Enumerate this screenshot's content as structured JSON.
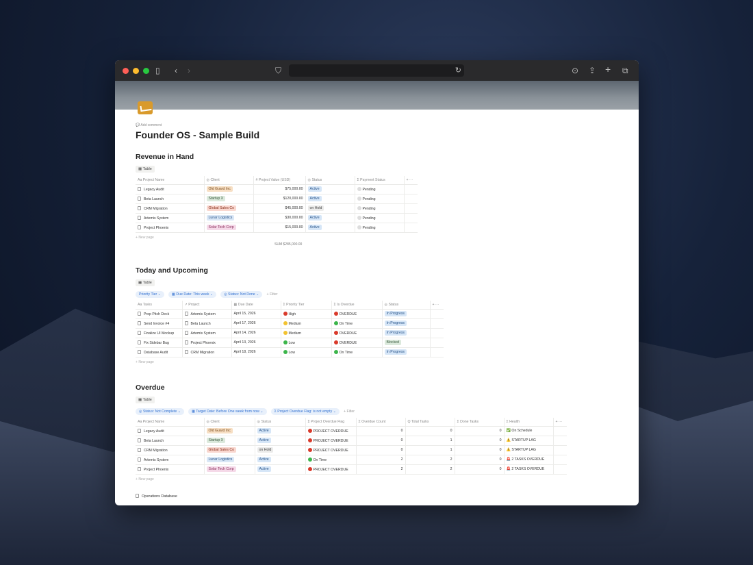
{
  "page": {
    "title": "Founder OS - Sample Build",
    "add_comment": "Add comment"
  },
  "colors": {
    "accent": "#2f6fd0",
    "status_blue": "#d9e7f6"
  },
  "revenue": {
    "title": "Revenue in Hand",
    "view": "Table",
    "columns": [
      "Aa  Project Name",
      "◎  Client",
      "#  Project Value (USD)",
      "◎  Status",
      "Σ  Payment Status",
      "+  ···"
    ],
    "rows": [
      {
        "name": "Legacy Audit",
        "client": "Old Guard Inc",
        "client_color": "orange",
        "value": "$75,000.00",
        "status": "Active",
        "payment": "Pending"
      },
      {
        "name": "Beta Launch",
        "client": "Startup X",
        "client_color": "green",
        "value": "$120,000.00",
        "status": "Active",
        "payment": "Pending"
      },
      {
        "name": "CRM Migration",
        "client": "Global Sales Co",
        "client_color": "red",
        "value": "$45,000.00",
        "status": "on Hold",
        "payment": "Pending"
      },
      {
        "name": "Artemis System",
        "client": "Lunar Logistics",
        "client_color": "blue",
        "value": "$30,000.00",
        "status": "Active",
        "payment": "Pending"
      },
      {
        "name": "Project Phoenix",
        "client": "Solar Tech Corp",
        "client_color": "pink",
        "value": "$15,000.00",
        "status": "Active",
        "payment": "Pending"
      }
    ],
    "new_page": "New page",
    "sum_label": "SUM",
    "sum_value": "$285,000.00"
  },
  "upcoming": {
    "title": "Today and Upcoming",
    "view": "Table",
    "filters": [
      "Priority Tier ⌄",
      "▦ Due Date: This week ⌄",
      "◎ Status: Not Done ⌄"
    ],
    "filter_add": "+ Filter",
    "columns": [
      "Aa  Tasks",
      "↗  Project",
      "▦  Due Date",
      "Σ  Priority Tier",
      "Σ  Is Overdue",
      "◎  Status",
      "+  ···"
    ],
    "rows": [
      {
        "task": "Prep Pitch Deck",
        "project": "Artemis System",
        "due": "April 15, 2026",
        "priority": "High",
        "prio_color": "#d93a2b",
        "overdue": "OVERDUE",
        "od_color": "#d93a2b",
        "status": "In Progress"
      },
      {
        "task": "Send Invoice #4",
        "project": "Beta Launch",
        "due": "April 17, 2026",
        "priority": "Medium",
        "prio_color": "#f2c230",
        "overdue": "On Time",
        "od_color": "#3cb54a",
        "status": "In Progress"
      },
      {
        "task": "Finalize UI Mockup",
        "project": "Artemis System",
        "due": "April 14, 2026",
        "priority": "Medium",
        "prio_color": "#f2c230",
        "overdue": "OVERDUE",
        "od_color": "#d93a2b",
        "status": "In Progress"
      },
      {
        "task": "Fix Sidebar Bug",
        "project": "Project Phoenix",
        "due": "April 13, 2026",
        "priority": "Low",
        "prio_color": "#3cb54a",
        "overdue": "OVERDUE",
        "od_color": "#d93a2b",
        "status": "Blocked"
      },
      {
        "task": "Database Audit",
        "project": "CRM Migration",
        "due": "April 18, 2026",
        "priority": "Low",
        "prio_color": "#3cb54a",
        "overdue": "On Time",
        "od_color": "#3cb54a",
        "status": "In Progress"
      }
    ],
    "new_page": "New page"
  },
  "overdue": {
    "title": "Overdue",
    "view": "Table",
    "filters": [
      "◎ Status: Not Complete ⌄",
      "▦ Target Date: Before One week from now ⌄",
      "Σ Project Overdue Flag: is not empty ⌄"
    ],
    "filter_add": "+ Filter",
    "columns": [
      "Aa  Project Name",
      "◎  Client",
      "◎  Status",
      "Σ  Project Overdue Flag",
      "Σ  Overdue Count",
      "Q  Total Tasks",
      "Σ  Done Tasks",
      "Σ  Health",
      "+  ···"
    ],
    "rows": [
      {
        "name": "Legacy Audit",
        "client": "Old Guard Inc",
        "client_color": "orange",
        "status": "Active",
        "flag": "PROJECT OVERDUE",
        "flag_color": "#d93a2b",
        "overdue_count": "0",
        "total": "0",
        "done": "0",
        "health": "On Schedule",
        "health_icon": "✅"
      },
      {
        "name": "Beta Launch",
        "client": "Startup X",
        "client_color": "green",
        "status": "Active",
        "flag": "PROJECT OVERDUE",
        "flag_color": "#d93a2b",
        "overdue_count": "0",
        "total": "1",
        "done": "0",
        "health": "STARTUP LAG",
        "health_icon": "⚠️"
      },
      {
        "name": "CRM Migration",
        "client": "Global Sales Co",
        "client_color": "red",
        "status": "on Hold",
        "flag": "PROJECT OVERDUE",
        "flag_color": "#d93a2b",
        "overdue_count": "0",
        "total": "1",
        "done": "0",
        "health": "STARTUP LAG",
        "health_icon": "⚠️"
      },
      {
        "name": "Artemis System",
        "client": "Lunar Logistics",
        "client_color": "blue",
        "status": "Active",
        "flag": "On Time",
        "flag_color": "#3cb54a",
        "overdue_count": "2",
        "total": "2",
        "done": "0",
        "health": "2 TASKS OVERDUE",
        "health_icon": "🚨"
      },
      {
        "name": "Project Phoenix",
        "client": "Solar Tech Corp",
        "client_color": "pink",
        "status": "Active",
        "flag": "PROJECT OVERDUE",
        "flag_color": "#d93a2b",
        "overdue_count": "2",
        "total": "2",
        "done": "0",
        "health": "2 TASKS OVERDUE",
        "health_icon": "🚨"
      }
    ],
    "new_page": "New page"
  },
  "footer_link": "Operations Database"
}
